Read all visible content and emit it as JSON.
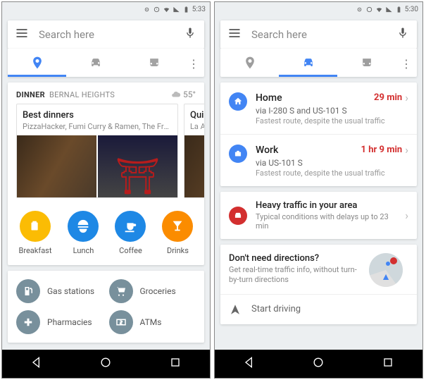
{
  "status": {
    "time_left": "5:33",
    "time_right": "5:30"
  },
  "search": {
    "placeholder": "Search here"
  },
  "left": {
    "section": {
      "category": "DINNER",
      "location": "BERNAL HEIGHTS",
      "temp": "55°"
    },
    "carousel": [
      {
        "title": "Best dinners",
        "sub": "PizzaHacker, Fumi Curry & Ramen, The Front...",
        "banner": "Fumi Curry & Ramen"
      },
      {
        "title": "Quick",
        "sub": "La Alt"
      }
    ],
    "cats": [
      {
        "label": "Breakfast",
        "color": "#fbbc04"
      },
      {
        "label": "Lunch",
        "color": "#1e88e5"
      },
      {
        "label": "Coffee",
        "color": "#1e88e5"
      },
      {
        "label": "Drinks",
        "color": "#fb8c00"
      }
    ],
    "services": [
      {
        "label": "Gas stations"
      },
      {
        "label": "Groceries"
      },
      {
        "label": "Pharmacies"
      },
      {
        "label": "ATMs"
      }
    ]
  },
  "right": {
    "dest": [
      {
        "name": "Home",
        "time": "29 min",
        "via": "via I-280 S and US-101 S",
        "note": "Fastest route, despite the usual traffic"
      },
      {
        "name": "Work",
        "time": "1 hr 9 min",
        "via": "via US-101 S",
        "note": "Fastest route, despite the usual traffic"
      }
    ],
    "traffic": {
      "title": "Heavy traffic in your area",
      "sub": "Typical conditions with delays up to 23 min"
    },
    "promo": {
      "title": "Don't need directions?",
      "sub": "Get real-time traffic info, without turn-by-turn directions"
    },
    "start": "Start driving"
  }
}
